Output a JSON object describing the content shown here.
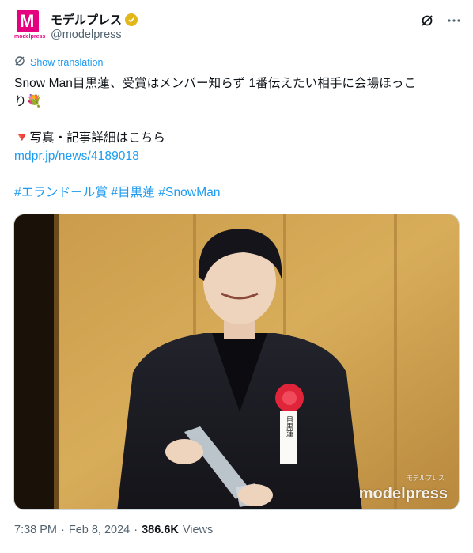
{
  "account": {
    "display_name": "モデルプレス",
    "handle": "@modelpress",
    "avatar_text": "M",
    "avatar_word": "modelpress",
    "verified_color": "#e2b719"
  },
  "translate": {
    "label": "Show translation"
  },
  "tweet": {
    "line1": "Snow Man目黒蓮、受賞はメンバー知らず 1番伝えたい相手に会場ほっこ",
    "line2": "り💐",
    "line3": "🔻写真・記事詳細はこちら",
    "link": "mdpr.jp/news/4189018",
    "hashtags": [
      "#エランドール賞",
      "#目黒蓮",
      "#SnowMan"
    ]
  },
  "photo": {
    "watermark": "modelpress",
    "watermark_small": "モデルプレス",
    "ribbon_text": "目黒蓮"
  },
  "meta": {
    "time": "7:38 PM",
    "sep1": "·",
    "date": "Feb 8, 2024",
    "sep2": "·",
    "views_count": "386.6K",
    "views_label": "Views"
  },
  "colors": {
    "accent": "#1d9bf0",
    "brand": "#e4007f",
    "muted": "#536471"
  }
}
